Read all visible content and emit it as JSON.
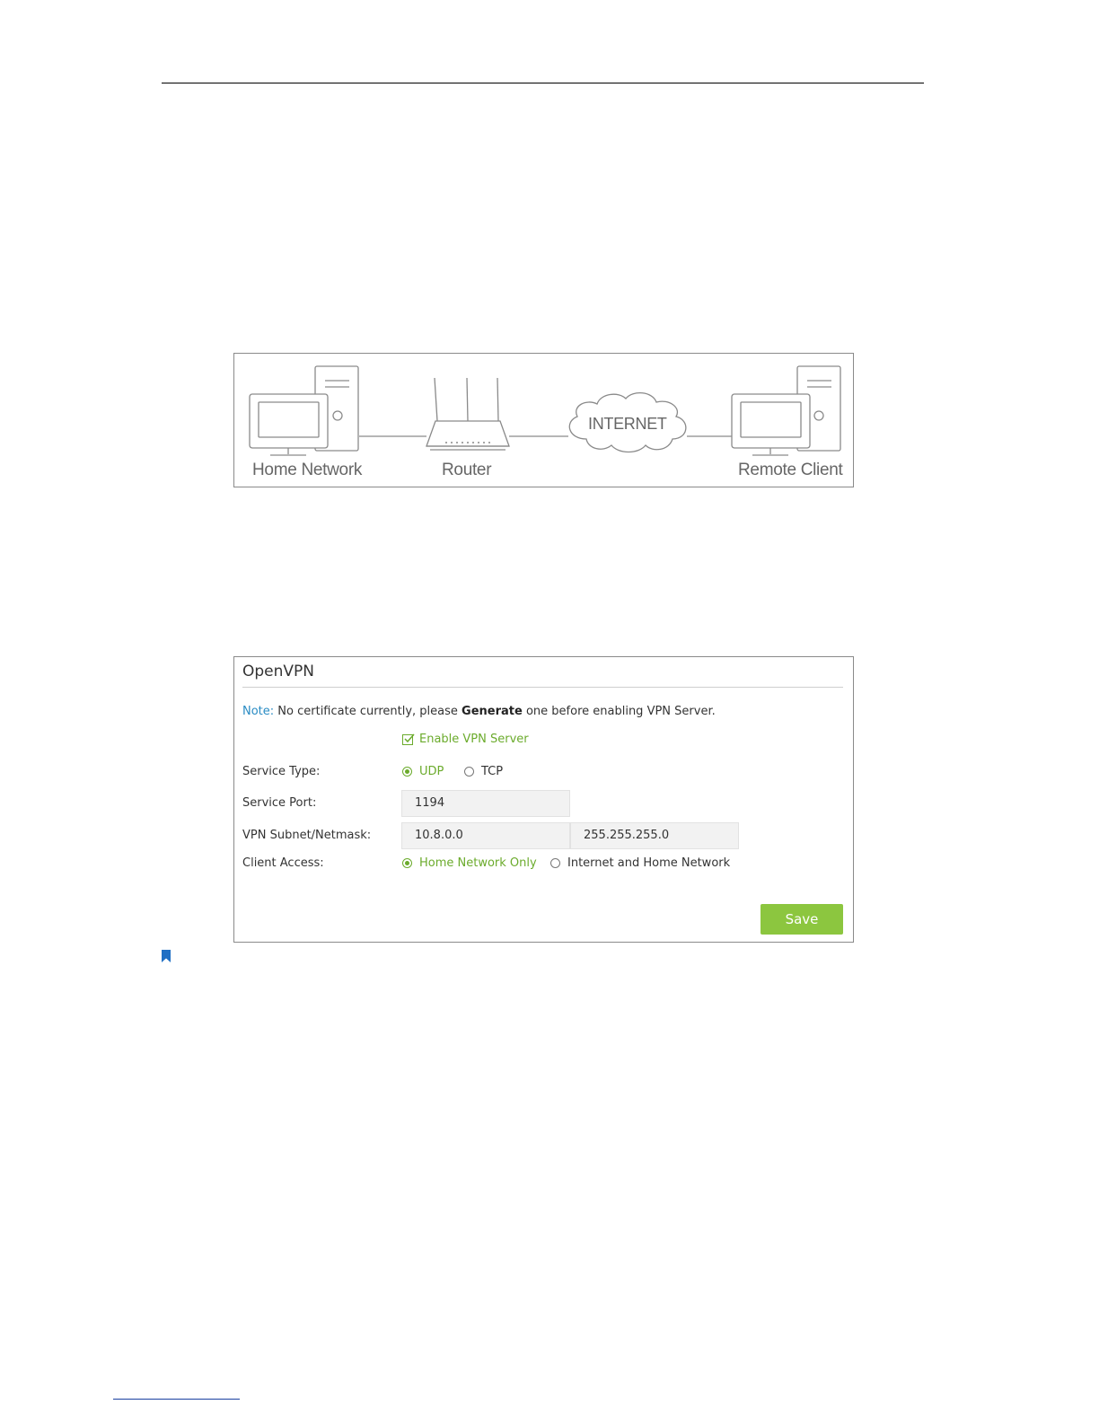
{
  "diagram": {
    "labels": {
      "home_network": "Home Network",
      "router": "Router",
      "internet": "INTERNET",
      "remote_client": "Remote Client"
    }
  },
  "openvpn": {
    "title": "OpenVPN",
    "note": {
      "label": "Note:",
      "text_before": "No certificate currently, please",
      "bold": "Generate",
      "text_after": "one before enabling VPN Server."
    },
    "enable_vpn_server": {
      "label": "Enable VPN Server",
      "checked": true
    },
    "service_type": {
      "label": "Service Type:",
      "options": [
        "UDP",
        "TCP"
      ],
      "selected": "UDP"
    },
    "service_port": {
      "label": "Service Port:",
      "value": "1194"
    },
    "vpn_subnet": {
      "label": "VPN Subnet/Netmask:",
      "subnet": "10.8.0.0",
      "netmask": "255.255.255.0"
    },
    "client_access": {
      "label": "Client Access:",
      "options": [
        "Home Network Only",
        "Internet and Home Network"
      ],
      "selected": "Home Network Only"
    },
    "save_label": "Save"
  },
  "colors": {
    "accent_green": "#8cc63f",
    "selected_green": "#6bab2c",
    "note_blue": "#2a8cc4",
    "bookmark_blue": "#1f6fc4"
  },
  "icons": [
    "checkbox-checked-icon",
    "radio-selected-icon",
    "radio-unselected-icon",
    "bookmark-icon",
    "desktop-computer-icon",
    "router-icon",
    "cloud-icon"
  ]
}
